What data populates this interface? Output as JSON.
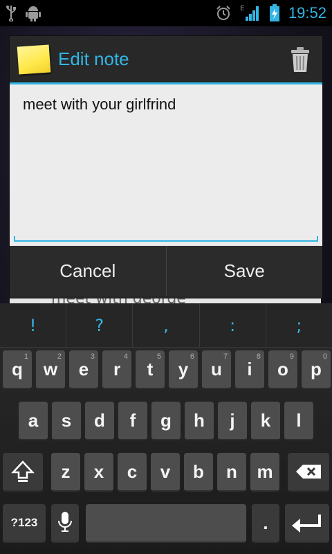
{
  "statusbar": {
    "time": "19:52",
    "network_type": "E",
    "icons": [
      "usb-icon",
      "android-debug-icon",
      "alarm-icon",
      "signal-icon",
      "battery-charging-icon"
    ]
  },
  "background": {
    "note_preview": "meet with george"
  },
  "dialog": {
    "title": "Edit note",
    "note_text": "meet with your girlfrind",
    "cancel_label": "Cancel",
    "save_label": "Save"
  },
  "keyboard": {
    "suggestions": [
      "!",
      "?",
      ",",
      ":",
      ";"
    ],
    "row1": [
      {
        "k": "q",
        "alt": "1"
      },
      {
        "k": "w",
        "alt": "2"
      },
      {
        "k": "e",
        "alt": "3"
      },
      {
        "k": "r",
        "alt": "4"
      },
      {
        "k": "t",
        "alt": "5"
      },
      {
        "k": "y",
        "alt": "6"
      },
      {
        "k": "u",
        "alt": "7"
      },
      {
        "k": "i",
        "alt": "8"
      },
      {
        "k": "o",
        "alt": "9"
      },
      {
        "k": "p",
        "alt": "0"
      }
    ],
    "row2": [
      "a",
      "s",
      "d",
      "f",
      "g",
      "h",
      "j",
      "k",
      "l"
    ],
    "row3": [
      "z",
      "x",
      "c",
      "v",
      "b",
      "n",
      "m"
    ],
    "symbols_label": "?123",
    "period_label": ".",
    "colors": {
      "accent": "#33b5e5",
      "key": "#4d4d4d"
    }
  }
}
